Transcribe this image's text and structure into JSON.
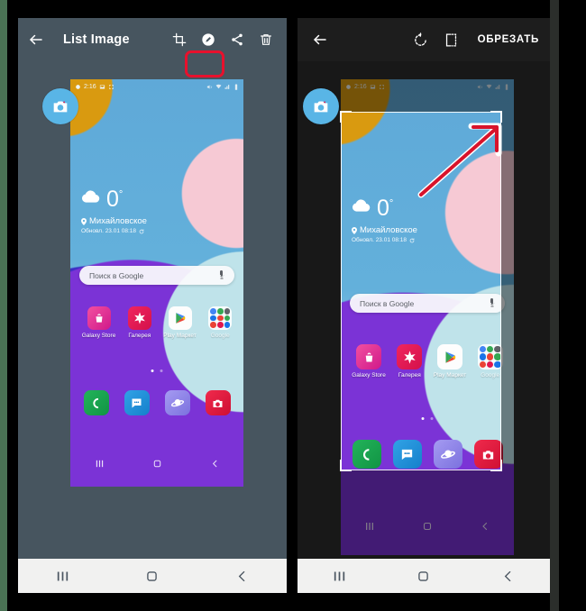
{
  "meta": {
    "accent_red": "#e8112d",
    "appbar_left_bg": "#47555f",
    "appbar_right_bg": "#1d1d1d",
    "panel_right_bg": "#2e2e2e"
  },
  "left_panel": {
    "appbar": {
      "back_icon": "arrow-left-icon",
      "title": "List Image",
      "actions": [
        {
          "name": "crop-button",
          "icon": "crop-icon",
          "highlighted": true
        },
        {
          "name": "edit-button",
          "icon": "pencil-circle-icon",
          "highlighted": false
        },
        {
          "name": "share-button",
          "icon": "share-icon",
          "highlighted": false
        },
        {
          "name": "delete-button",
          "icon": "trash-icon",
          "highlighted": false
        }
      ]
    },
    "badge": {
      "icon": "camera-badge-icon",
      "color": "#59b5e6"
    },
    "screenshot": {
      "statusbar": {
        "time": "2:16",
        "left_icons": [
          "alarm-icon",
          "image-icon",
          "screenshot-icon"
        ],
        "right_icons": [
          "mute-icon",
          "wifi-icon",
          "signal-icon",
          "battery-icon"
        ]
      },
      "weather": {
        "icon": "cloud-icon",
        "temperature": "0",
        "degree": "°",
        "location_icon": "pin-icon",
        "location": "Михайловское",
        "updated": "Обновл. 23.01 08:18",
        "refresh_icon": "refresh-icon"
      },
      "search": {
        "placeholder": "Поиск в Google",
        "mic_icon": "microphone-icon"
      },
      "apps": [
        {
          "label": "Galaxy Store",
          "icon": "galaxy-store-icon",
          "color": "#e0218a"
        },
        {
          "label": "Галерея",
          "icon": "gallery-icon",
          "color": "#e0184f"
        },
        {
          "label": "Play Маркет",
          "icon": "play-store-icon",
          "color": "#ffffff"
        },
        {
          "label": "Google",
          "icon": "google-folder-icon",
          "color": "#f0f0f0"
        }
      ],
      "page_dots": {
        "count": 2,
        "active_index": 0
      },
      "dock": [
        {
          "name": "phone-app",
          "icon": "phone-icon",
          "color": "#1a9c4b"
        },
        {
          "name": "messages-app",
          "icon": "message-icon",
          "color": "#1f8ed6"
        },
        {
          "name": "internet-app",
          "icon": "internet-icon",
          "color": "#8d86e8"
        },
        {
          "name": "camera-app",
          "icon": "camera-icon",
          "color": "#e01f3d"
        }
      ],
      "navbar": {
        "recents_icon": "recents-icon",
        "home_icon": "home-icon",
        "back_icon": "back-icon"
      }
    },
    "sysnav": {
      "recents_icon": "recents-icon",
      "home_icon": "home-icon",
      "back_icon": "back-icon"
    }
  },
  "right_panel": {
    "appbar": {
      "back_icon": "arrow-left-icon",
      "actions": [
        {
          "name": "rotate-button",
          "icon": "rotate-cw-icon"
        },
        {
          "name": "flip-button",
          "icon": "flip-horizontal-icon"
        }
      ],
      "confirm_label": "ОБРЕЗАТЬ"
    },
    "badge": {
      "icon": "camera-badge-icon",
      "color": "#59b5e6"
    },
    "crop": {
      "handles": [
        "top-left",
        "top-right",
        "bottom-left",
        "bottom-right"
      ],
      "annotation": {
        "type": "arrow",
        "color": "#d8132b",
        "points_to": "top-right-handle"
      }
    },
    "screenshot": {
      "statusbar": {
        "time": "2:16",
        "left_icons": [
          "alarm-icon",
          "image-icon",
          "screenshot-icon"
        ],
        "right_icons": [
          "mute-icon",
          "wifi-icon",
          "signal-icon",
          "battery-icon"
        ]
      },
      "weather": {
        "icon": "cloud-icon",
        "temperature": "0",
        "degree": "°",
        "location_icon": "pin-icon",
        "location": "Михайловское",
        "updated": "Обновл. 23.01 08:18",
        "refresh_icon": "refresh-icon"
      },
      "search": {
        "placeholder": "Поиск в Google",
        "mic_icon": "microphone-icon"
      },
      "apps": [
        {
          "label": "Galaxy Store",
          "icon": "galaxy-store-icon",
          "color": "#e0218a"
        },
        {
          "label": "Галерея",
          "icon": "gallery-icon",
          "color": "#e0184f"
        },
        {
          "label": "Play Маркет",
          "icon": "play-store-icon",
          "color": "#ffffff"
        },
        {
          "label": "Google",
          "icon": "google-folder-icon",
          "color": "#f0f0f0"
        }
      ],
      "page_dots": {
        "count": 2,
        "active_index": 0
      },
      "dock": [
        {
          "name": "phone-app",
          "icon": "phone-icon",
          "color": "#1a9c4b"
        },
        {
          "name": "messages-app",
          "icon": "message-icon",
          "color": "#1f8ed6"
        },
        {
          "name": "internet-app",
          "icon": "internet-icon",
          "color": "#8d86e8"
        },
        {
          "name": "camera-app",
          "icon": "camera-icon",
          "color": "#e01f3d"
        }
      ],
      "navbar": {
        "recents_icon": "recents-icon",
        "home_icon": "home-icon",
        "back_icon": "back-icon"
      }
    },
    "sysnav": {
      "recents_icon": "recents-icon",
      "home_icon": "home-icon",
      "back_icon": "back-icon"
    }
  }
}
